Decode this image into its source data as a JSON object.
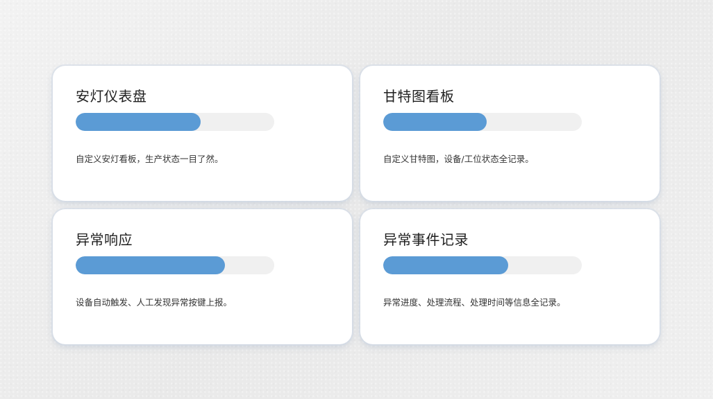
{
  "cards": [
    {
      "title": "安灯仪表盘",
      "progress": 0.63,
      "description": "自定义安灯看板，生产状态一目了然。"
    },
    {
      "title": "甘特图看板",
      "progress": 0.52,
      "description": "自定义甘特图，设备/工位状态全记录。"
    },
    {
      "title": "异常响应",
      "progress": 0.75,
      "description": "设备自动触发、人工发现异常按键上报。"
    },
    {
      "title": "异常事件记录",
      "progress": 0.63,
      "description": "异常进度、处理流程、处理时间等信息全记录。"
    }
  ],
  "colors": {
    "accent": "#5b9bd5",
    "track": "#f0f0f0",
    "card": "#ffffff"
  }
}
